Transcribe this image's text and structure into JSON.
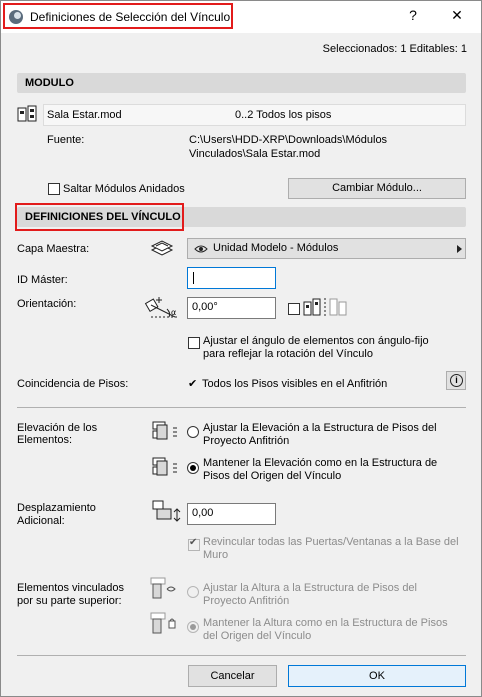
{
  "window": {
    "title": "Definiciones de Selección del Vínculo",
    "help_label": "?",
    "close_label": "✕"
  },
  "status": {
    "selection": "Seleccionados: 1 Editables: 1"
  },
  "module_section": {
    "header": "MODULO",
    "module_name": "Sala Estar.mod",
    "stories": "0..2 Todos los pisos",
    "source_label": "Fuente:",
    "source_path_line1": "C:\\Users\\HDD-XRP\\Downloads\\Módulos",
    "source_path_line2": "Vinculados\\Sala Estar.mod",
    "skip_nested_label": "Saltar Módulos Anidados",
    "skip_nested_checked": false,
    "change_module_label": "Cambiar Módulo..."
  },
  "link_section": {
    "header": "DEFINICIONES DEL VÍNCULO",
    "master_layer_label": "Capa Maestra:",
    "master_layer_value": "Unidad Modelo - Módulos",
    "master_id_label": "ID Máster:",
    "master_id_value": "",
    "orientation_label": "Orientación:",
    "orientation_value": "0,00°",
    "mirror_checked": false,
    "adjust_angle_label_line1": "Ajustar el ángulo de elementos con ángulo-fijo",
    "adjust_angle_label_line2": "para reflejar la rotación del Vínculo",
    "adjust_angle_checked": false,
    "story_match_label": "Coincidencia de Pisos:",
    "story_match_value": "Todos los Pisos visibles en el Anfitrión",
    "story_match_check": "✔",
    "info_label": "i"
  },
  "elevation": {
    "label_line1": "Elevación de los",
    "label_line2": "Elementos:",
    "option1_line1": "Ajustar la Elevación a la Estructura de Pisos del",
    "option1_line2": "Proyecto Anfitrión",
    "option2_line1": "Mantener la Elevación como en la Estructura de",
    "option2_line2": "Pisos del Origen del Vínculo",
    "selected": 2
  },
  "offset": {
    "label_line1": "Desplazamiento",
    "label_line2": "Adicional:",
    "value": "0,00",
    "relink_line1": "Revincular todas las Puertas/Ventanas a la Base del",
    "relink_line2": "Muro",
    "relink_checked": true
  },
  "top_linked": {
    "label_line1": "Elementos vinculados",
    "label_line2": "por su parte superior:",
    "option1_line1": "Ajustar la Altura a la Estructura de Pisos del",
    "option1_line2": "Proyecto Anfitrión",
    "option2_line1": "Mantener la Altura como en la Estructura de Pisos",
    "option2_line2": "del Origen del Vínculo",
    "selected": 2
  },
  "footer": {
    "cancel_label": "Cancelar",
    "ok_label": "OK"
  },
  "colors": {
    "highlight_box": "#e21b1b",
    "section_bg": "#d9d9d9",
    "primary_border": "#0078d7"
  }
}
